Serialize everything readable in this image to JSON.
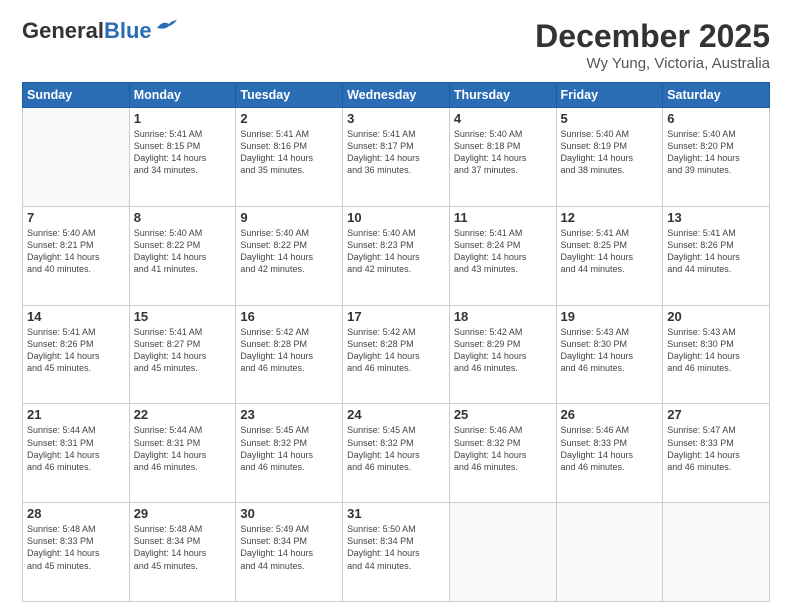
{
  "header": {
    "logo_general": "General",
    "logo_blue": "Blue",
    "month": "December 2025",
    "location": "Wy Yung, Victoria, Australia"
  },
  "weekdays": [
    "Sunday",
    "Monday",
    "Tuesday",
    "Wednesday",
    "Thursday",
    "Friday",
    "Saturday"
  ],
  "weeks": [
    [
      {
        "day": "",
        "sunrise": "",
        "sunset": "",
        "daylight": ""
      },
      {
        "day": "1",
        "sunrise": "Sunrise: 5:41 AM",
        "sunset": "Sunset: 8:15 PM",
        "daylight": "Daylight: 14 hours and 34 minutes."
      },
      {
        "day": "2",
        "sunrise": "Sunrise: 5:41 AM",
        "sunset": "Sunset: 8:16 PM",
        "daylight": "Daylight: 14 hours and 35 minutes."
      },
      {
        "day": "3",
        "sunrise": "Sunrise: 5:41 AM",
        "sunset": "Sunset: 8:17 PM",
        "daylight": "Daylight: 14 hours and 36 minutes."
      },
      {
        "day": "4",
        "sunrise": "Sunrise: 5:40 AM",
        "sunset": "Sunset: 8:18 PM",
        "daylight": "Daylight: 14 hours and 37 minutes."
      },
      {
        "day": "5",
        "sunrise": "Sunrise: 5:40 AM",
        "sunset": "Sunset: 8:19 PM",
        "daylight": "Daylight: 14 hours and 38 minutes."
      },
      {
        "day": "6",
        "sunrise": "Sunrise: 5:40 AM",
        "sunset": "Sunset: 8:20 PM",
        "daylight": "Daylight: 14 hours and 39 minutes."
      }
    ],
    [
      {
        "day": "7",
        "sunrise": "Sunrise: 5:40 AM",
        "sunset": "Sunset: 8:21 PM",
        "daylight": "Daylight: 14 hours and 40 minutes."
      },
      {
        "day": "8",
        "sunrise": "Sunrise: 5:40 AM",
        "sunset": "Sunset: 8:22 PM",
        "daylight": "Daylight: 14 hours and 41 minutes."
      },
      {
        "day": "9",
        "sunrise": "Sunrise: 5:40 AM",
        "sunset": "Sunset: 8:22 PM",
        "daylight": "Daylight: 14 hours and 42 minutes."
      },
      {
        "day": "10",
        "sunrise": "Sunrise: 5:40 AM",
        "sunset": "Sunset: 8:23 PM",
        "daylight": "Daylight: 14 hours and 42 minutes."
      },
      {
        "day": "11",
        "sunrise": "Sunrise: 5:41 AM",
        "sunset": "Sunset: 8:24 PM",
        "daylight": "Daylight: 14 hours and 43 minutes."
      },
      {
        "day": "12",
        "sunrise": "Sunrise: 5:41 AM",
        "sunset": "Sunset: 8:25 PM",
        "daylight": "Daylight: 14 hours and 44 minutes."
      },
      {
        "day": "13",
        "sunrise": "Sunrise: 5:41 AM",
        "sunset": "Sunset: 8:26 PM",
        "daylight": "Daylight: 14 hours and 44 minutes."
      }
    ],
    [
      {
        "day": "14",
        "sunrise": "Sunrise: 5:41 AM",
        "sunset": "Sunset: 8:26 PM",
        "daylight": "Daylight: 14 hours and 45 minutes."
      },
      {
        "day": "15",
        "sunrise": "Sunrise: 5:41 AM",
        "sunset": "Sunset: 8:27 PM",
        "daylight": "Daylight: 14 hours and 45 minutes."
      },
      {
        "day": "16",
        "sunrise": "Sunrise: 5:42 AM",
        "sunset": "Sunset: 8:28 PM",
        "daylight": "Daylight: 14 hours and 46 minutes."
      },
      {
        "day": "17",
        "sunrise": "Sunrise: 5:42 AM",
        "sunset": "Sunset: 8:28 PM",
        "daylight": "Daylight: 14 hours and 46 minutes."
      },
      {
        "day": "18",
        "sunrise": "Sunrise: 5:42 AM",
        "sunset": "Sunset: 8:29 PM",
        "daylight": "Daylight: 14 hours and 46 minutes."
      },
      {
        "day": "19",
        "sunrise": "Sunrise: 5:43 AM",
        "sunset": "Sunset: 8:30 PM",
        "daylight": "Daylight: 14 hours and 46 minutes."
      },
      {
        "day": "20",
        "sunrise": "Sunrise: 5:43 AM",
        "sunset": "Sunset: 8:30 PM",
        "daylight": "Daylight: 14 hours and 46 minutes."
      }
    ],
    [
      {
        "day": "21",
        "sunrise": "Sunrise: 5:44 AM",
        "sunset": "Sunset: 8:31 PM",
        "daylight": "Daylight: 14 hours and 46 minutes."
      },
      {
        "day": "22",
        "sunrise": "Sunrise: 5:44 AM",
        "sunset": "Sunset: 8:31 PM",
        "daylight": "Daylight: 14 hours and 46 minutes."
      },
      {
        "day": "23",
        "sunrise": "Sunrise: 5:45 AM",
        "sunset": "Sunset: 8:32 PM",
        "daylight": "Daylight: 14 hours and 46 minutes."
      },
      {
        "day": "24",
        "sunrise": "Sunrise: 5:45 AM",
        "sunset": "Sunset: 8:32 PM",
        "daylight": "Daylight: 14 hours and 46 minutes."
      },
      {
        "day": "25",
        "sunrise": "Sunrise: 5:46 AM",
        "sunset": "Sunset: 8:32 PM",
        "daylight": "Daylight: 14 hours and 46 minutes."
      },
      {
        "day": "26",
        "sunrise": "Sunrise: 5:46 AM",
        "sunset": "Sunset: 8:33 PM",
        "daylight": "Daylight: 14 hours and 46 minutes."
      },
      {
        "day": "27",
        "sunrise": "Sunrise: 5:47 AM",
        "sunset": "Sunset: 8:33 PM",
        "daylight": "Daylight: 14 hours and 46 minutes."
      }
    ],
    [
      {
        "day": "28",
        "sunrise": "Sunrise: 5:48 AM",
        "sunset": "Sunset: 8:33 PM",
        "daylight": "Daylight: 14 hours and 45 minutes."
      },
      {
        "day": "29",
        "sunrise": "Sunrise: 5:48 AM",
        "sunset": "Sunset: 8:34 PM",
        "daylight": "Daylight: 14 hours and 45 minutes."
      },
      {
        "day": "30",
        "sunrise": "Sunrise: 5:49 AM",
        "sunset": "Sunset: 8:34 PM",
        "daylight": "Daylight: 14 hours and 44 minutes."
      },
      {
        "day": "31",
        "sunrise": "Sunrise: 5:50 AM",
        "sunset": "Sunset: 8:34 PM",
        "daylight": "Daylight: 14 hours and 44 minutes."
      },
      {
        "day": "",
        "sunrise": "",
        "sunset": "",
        "daylight": ""
      },
      {
        "day": "",
        "sunrise": "",
        "sunset": "",
        "daylight": ""
      },
      {
        "day": "",
        "sunrise": "",
        "sunset": "",
        "daylight": ""
      }
    ]
  ]
}
